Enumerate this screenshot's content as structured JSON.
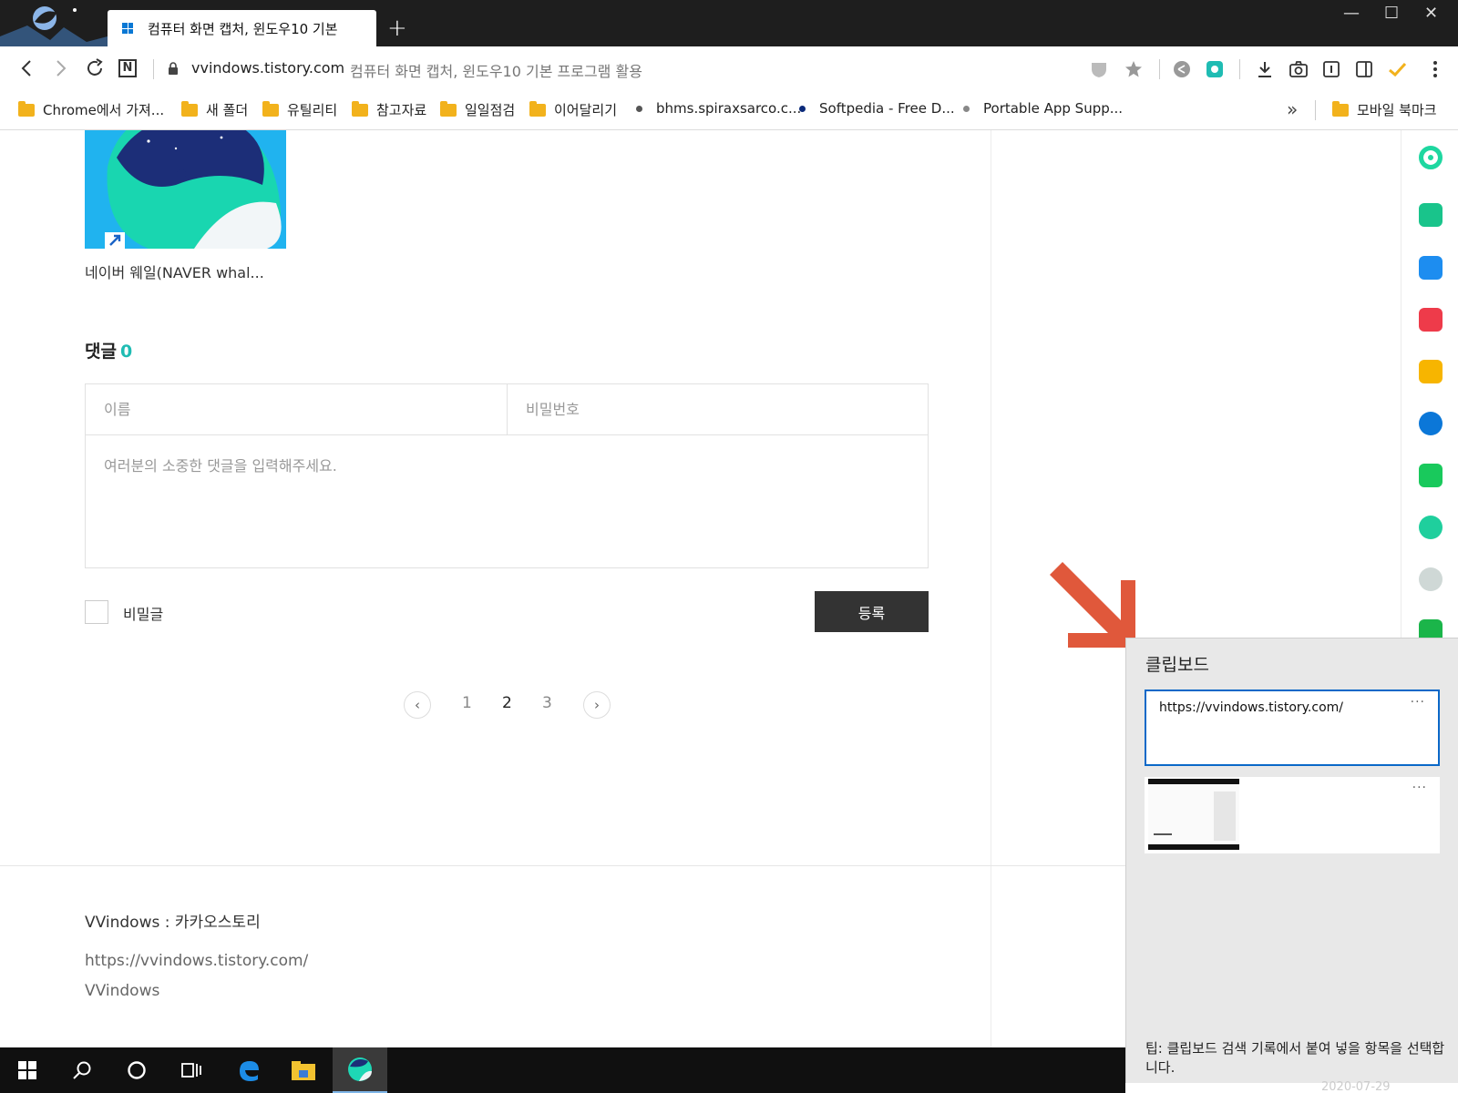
{
  "browser": {
    "tab_title": "컴퓨터 화면 캡처, 윈도우10 기본",
    "new_tab_label": "+",
    "url_host": "vvindows.tistory.com",
    "url_page_title": "컴퓨터 화면 캡처, 윈도우10 기본 프로그램 활용",
    "window_controls": {
      "minimize": "—",
      "maximize": "☐",
      "close": "✕"
    }
  },
  "bookmarks": {
    "items": [
      {
        "label": "Chrome에서 가져...",
        "type": "folder"
      },
      {
        "label": "새 폴더",
        "type": "folder"
      },
      {
        "label": "유틸리티",
        "type": "folder"
      },
      {
        "label": "참고자료",
        "type": "folder"
      },
      {
        "label": "일일점검",
        "type": "folder"
      },
      {
        "label": "이어달리기",
        "type": "folder"
      },
      {
        "label": "bhms.spiraxsarco.c...",
        "type": "site"
      },
      {
        "label": "Softpedia - Free D...",
        "type": "site"
      },
      {
        "label": "Portable App Supp...",
        "type": "site"
      }
    ],
    "more_label": "»",
    "mobile_label": "모바일 북마크"
  },
  "content": {
    "thumb_label": "네이버 웨일(NAVER whal...",
    "comments_title": "댓글",
    "comments_count": "0",
    "name_placeholder": "이름",
    "password_placeholder": "비밀번호",
    "comment_placeholder": "여러분의 소중한 댓글을 입력해주세요.",
    "secret_label": "비밀글",
    "submit_label": "등록",
    "pagination": {
      "prev": "‹",
      "next": "›",
      "pages": [
        "1",
        "2",
        "3"
      ],
      "current": "2"
    },
    "footer": {
      "blog_name": "VVindows : 카카오스토리",
      "url": "https://vvindows.tistory.com/",
      "author": "VVindows"
    }
  },
  "clipboard": {
    "title": "클립보드",
    "items": [
      {
        "text": "https://vvindows.tistory.com/",
        "more": "···"
      },
      {
        "text": "",
        "more": "···"
      }
    ],
    "tip": "팁: 클립보드 검색 기록에서 붙여 넣을 항목을 선택합니다."
  },
  "taskbar": {
    "date": "2020-07-29"
  },
  "colors": {
    "accent": "#1fbcb3",
    "selection": "#0a68c8",
    "annotation_arrow": "#e0583b",
    "button_dark": "#333333"
  }
}
